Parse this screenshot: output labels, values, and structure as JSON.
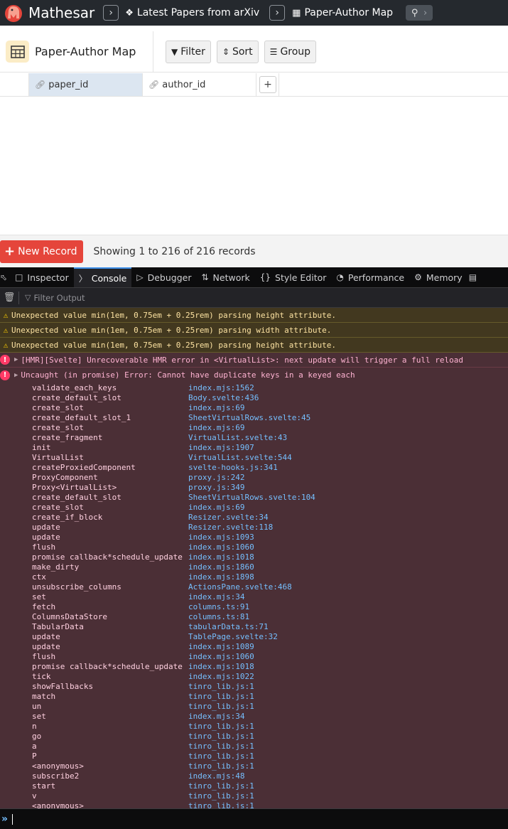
{
  "topbar": {
    "app_name": "Mathesar",
    "crumbs": [
      {
        "label": "Latest Papers from arXiv",
        "icon": "schema-icon"
      },
      {
        "label": "Paper-Author Map",
        "icon": "table-icon"
      }
    ]
  },
  "table_header": {
    "title": "Paper-Author Map",
    "buttons": {
      "filter": "Filter",
      "sort": "Sort",
      "group": "Group"
    }
  },
  "grid": {
    "columns": [
      {
        "label": "paper_id",
        "icon": "link-icon"
      },
      {
        "label": "author_id",
        "icon": "link-icon"
      }
    ],
    "add_column_label": "+"
  },
  "footer": {
    "new_record_label": "New Record",
    "records_info": "Showing 1 to 216 of 216 records"
  },
  "devtools": {
    "tabs": [
      {
        "label": "Inspector",
        "icon": "inspector-icon"
      },
      {
        "label": "Console",
        "icon": "console-icon"
      },
      {
        "label": "Debugger",
        "icon": "debugger-icon"
      },
      {
        "label": "Network",
        "icon": "network-icon"
      },
      {
        "label": "Style Editor",
        "icon": "style-editor-icon"
      },
      {
        "label": "Performance",
        "icon": "performance-icon"
      },
      {
        "label": "Memory",
        "icon": "memory-icon"
      }
    ],
    "filter_placeholder": "Filter Output",
    "warnings": [
      "Unexpected value min(1em, 0.75em + 0.25rem) parsing height attribute.",
      "Unexpected value min(1em, 0.75em + 0.25rem) parsing width attribute.",
      "Unexpected value min(1em, 0.75em + 0.25rem) parsing height attribute."
    ],
    "hmr_error": "[HMR][Svelte] Unrecoverable HMR error in <VirtualList>: next update will trigger a full reload",
    "uncaught_error": "Uncaught (in promise) Error: Cannot have duplicate keys in a keyed each",
    "stack": [
      {
        "fn": "validate_each_keys",
        "loc": "index.mjs:1562"
      },
      {
        "fn": "create_default_slot",
        "loc": "Body.svelte:436"
      },
      {
        "fn": "create_slot",
        "loc": "index.mjs:69"
      },
      {
        "fn": "create_default_slot_1",
        "loc": "SheetVirtualRows.svelte:45"
      },
      {
        "fn": "create_slot",
        "loc": "index.mjs:69"
      },
      {
        "fn": "create_fragment",
        "loc": "VirtualList.svelte:43"
      },
      {
        "fn": "init",
        "loc": "index.mjs:1907"
      },
      {
        "fn": "VirtualList",
        "loc": "VirtualList.svelte:544"
      },
      {
        "fn": "createProxiedComponent",
        "loc": "svelte-hooks.js:341"
      },
      {
        "fn": "ProxyComponent",
        "loc": "proxy.js:242"
      },
      {
        "fn": "Proxy<VirtualList>",
        "loc": "proxy.js:349"
      },
      {
        "fn": "create_default_slot",
        "loc": "SheetVirtualRows.svelte:104"
      },
      {
        "fn": "create_slot",
        "loc": "index.mjs:69"
      },
      {
        "fn": "create_if_block",
        "loc": "Resizer.svelte:34"
      },
      {
        "fn": "update",
        "loc": "Resizer.svelte:118"
      },
      {
        "fn": "update",
        "loc": "index.mjs:1093"
      },
      {
        "fn": "flush",
        "loc": "index.mjs:1060"
      },
      {
        "fn": "promise callback*schedule_update",
        "loc": "index.mjs:1018"
      },
      {
        "fn": "make_dirty",
        "loc": "index.mjs:1860"
      },
      {
        "fn": "ctx",
        "loc": "index.mjs:1898"
      },
      {
        "fn": "unsubscribe_columns",
        "loc": "ActionsPane.svelte:468"
      },
      {
        "fn": "set",
        "loc": "index.mjs:34"
      },
      {
        "fn": "fetch",
        "loc": "columns.ts:91"
      },
      {
        "fn": "ColumnsDataStore",
        "loc": "columns.ts:81"
      },
      {
        "fn": "TabularData",
        "loc": "tabularData.ts:71"
      },
      {
        "fn": "update",
        "loc": "TablePage.svelte:32"
      },
      {
        "fn": "update",
        "loc": "index.mjs:1089"
      },
      {
        "fn": "flush",
        "loc": "index.mjs:1060"
      },
      {
        "fn": "promise callback*schedule_update",
        "loc": "index.mjs:1018"
      },
      {
        "fn": "tick",
        "loc": "index.mjs:1022"
      },
      {
        "fn": "showFallbacks",
        "loc": "tinro_lib.js:1"
      },
      {
        "fn": "match",
        "loc": "tinro_lib.js:1"
      },
      {
        "fn": "un",
        "loc": "tinro_lib.js:1"
      },
      {
        "fn": "set",
        "loc": "index.mjs:34"
      },
      {
        "fn": "n",
        "loc": "tinro_lib.js:1"
      },
      {
        "fn": "go",
        "loc": "tinro_lib.js:1"
      },
      {
        "fn": "a",
        "loc": "tinro_lib.js:1"
      },
      {
        "fn": "P",
        "loc": "tinro_lib.js:1"
      },
      {
        "fn": "<anonymous>",
        "loc": "tinro_lib.js:1"
      },
      {
        "fn": "subscribe2",
        "loc": "index.mjs:48"
      },
      {
        "fn": "start",
        "loc": "tinro_lib.js:1"
      },
      {
        "fn": "v",
        "loc": "tinro_lib.js:1"
      },
      {
        "fn": "<anonymous>",
        "loc": "tinro_lib.js:1"
      }
    ]
  },
  "colors": {
    "topbar_bg": "#25292e",
    "accent_red": "#e5453b",
    "table_icon_bg": "#fbecc6",
    "selected_column_bg": "#dce6f1",
    "console_error_bg": "#4b2f36",
    "console_warn_bg": "#42381f",
    "link_blue": "#75bfff"
  }
}
